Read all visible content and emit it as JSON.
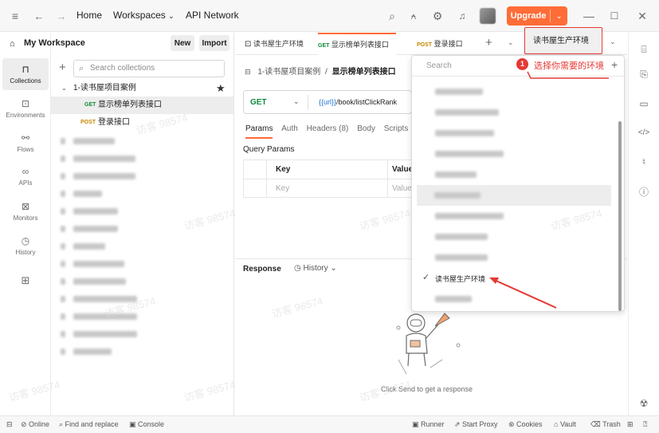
{
  "topbar": {
    "home": "Home",
    "workspaces": "Workspaces",
    "api_network": "API Network",
    "upgrade": "Upgrade",
    "icons": [
      "hamburger-icon",
      "back-arrow-icon",
      "forward-arrow-icon",
      "search-icon",
      "invite-user-icon",
      "settings-icon",
      "bell-icon",
      "avatar",
      "minimize-icon",
      "maximize-icon",
      "close-icon"
    ]
  },
  "leftrail": {
    "items": [
      {
        "label": "Collections",
        "icon": "collections-icon"
      },
      {
        "label": "Environments",
        "icon": "environments-icon"
      },
      {
        "label": "Flows",
        "icon": "flows-icon"
      },
      {
        "label": "APIs",
        "icon": "apis-icon"
      },
      {
        "label": "Monitors",
        "icon": "monitors-icon"
      },
      {
        "label": "History",
        "icon": "history-icon"
      }
    ]
  },
  "sidebar": {
    "workspace": "My Workspace",
    "new": "New",
    "import": "Import",
    "search_placeholder": "Search collections",
    "collection": "1-读书屋项目案例",
    "requests": [
      {
        "method": "GET",
        "name": "显示榜单列表接口"
      },
      {
        "method": "POST",
        "name": "登录接口"
      }
    ]
  },
  "tabs": [
    {
      "method": "",
      "name": "读书屋生产环境"
    },
    {
      "method": "GET",
      "name": "显示榜单列表接口"
    },
    {
      "method": "POST",
      "name": "登录接口"
    }
  ],
  "environment_selector": {
    "value": "读书屋生产环境"
  },
  "breadcrumb": {
    "collection": "1-读书屋项目案例",
    "separator": "/",
    "request": "显示榜单列表接口"
  },
  "request": {
    "method": "GET",
    "url_var": "{{url}}",
    "url_path": "/book/listClickRank",
    "subtabs": [
      "Params",
      "Auth",
      "Headers (8)",
      "Body",
      "Scripts"
    ],
    "query_params_label": "Query Params",
    "table_headers": [
      "Key",
      "Value"
    ],
    "table_placeholder": [
      "Key",
      "Value"
    ]
  },
  "response": {
    "label": "Response",
    "history": "History",
    "empty_text": "Click Send to get a response"
  },
  "dropdown": {
    "search_placeholder": "Search",
    "selected": "读书屋生产环境",
    "annotation_number": "1",
    "annotation_text": "选择你需要的环境"
  },
  "status": {
    "online": "Online",
    "find_replace": "Find and replace",
    "console": "Console",
    "runner": "Runner",
    "start_proxy": "Start Proxy",
    "cookies": "Cookies",
    "vault": "Vault",
    "trash": "Trash"
  },
  "watermark": "访客 98574",
  "colors": {
    "accent": "#ff6c37",
    "annotation": "#e53935",
    "get": "#0f8a3a",
    "post": "#c38b00"
  }
}
